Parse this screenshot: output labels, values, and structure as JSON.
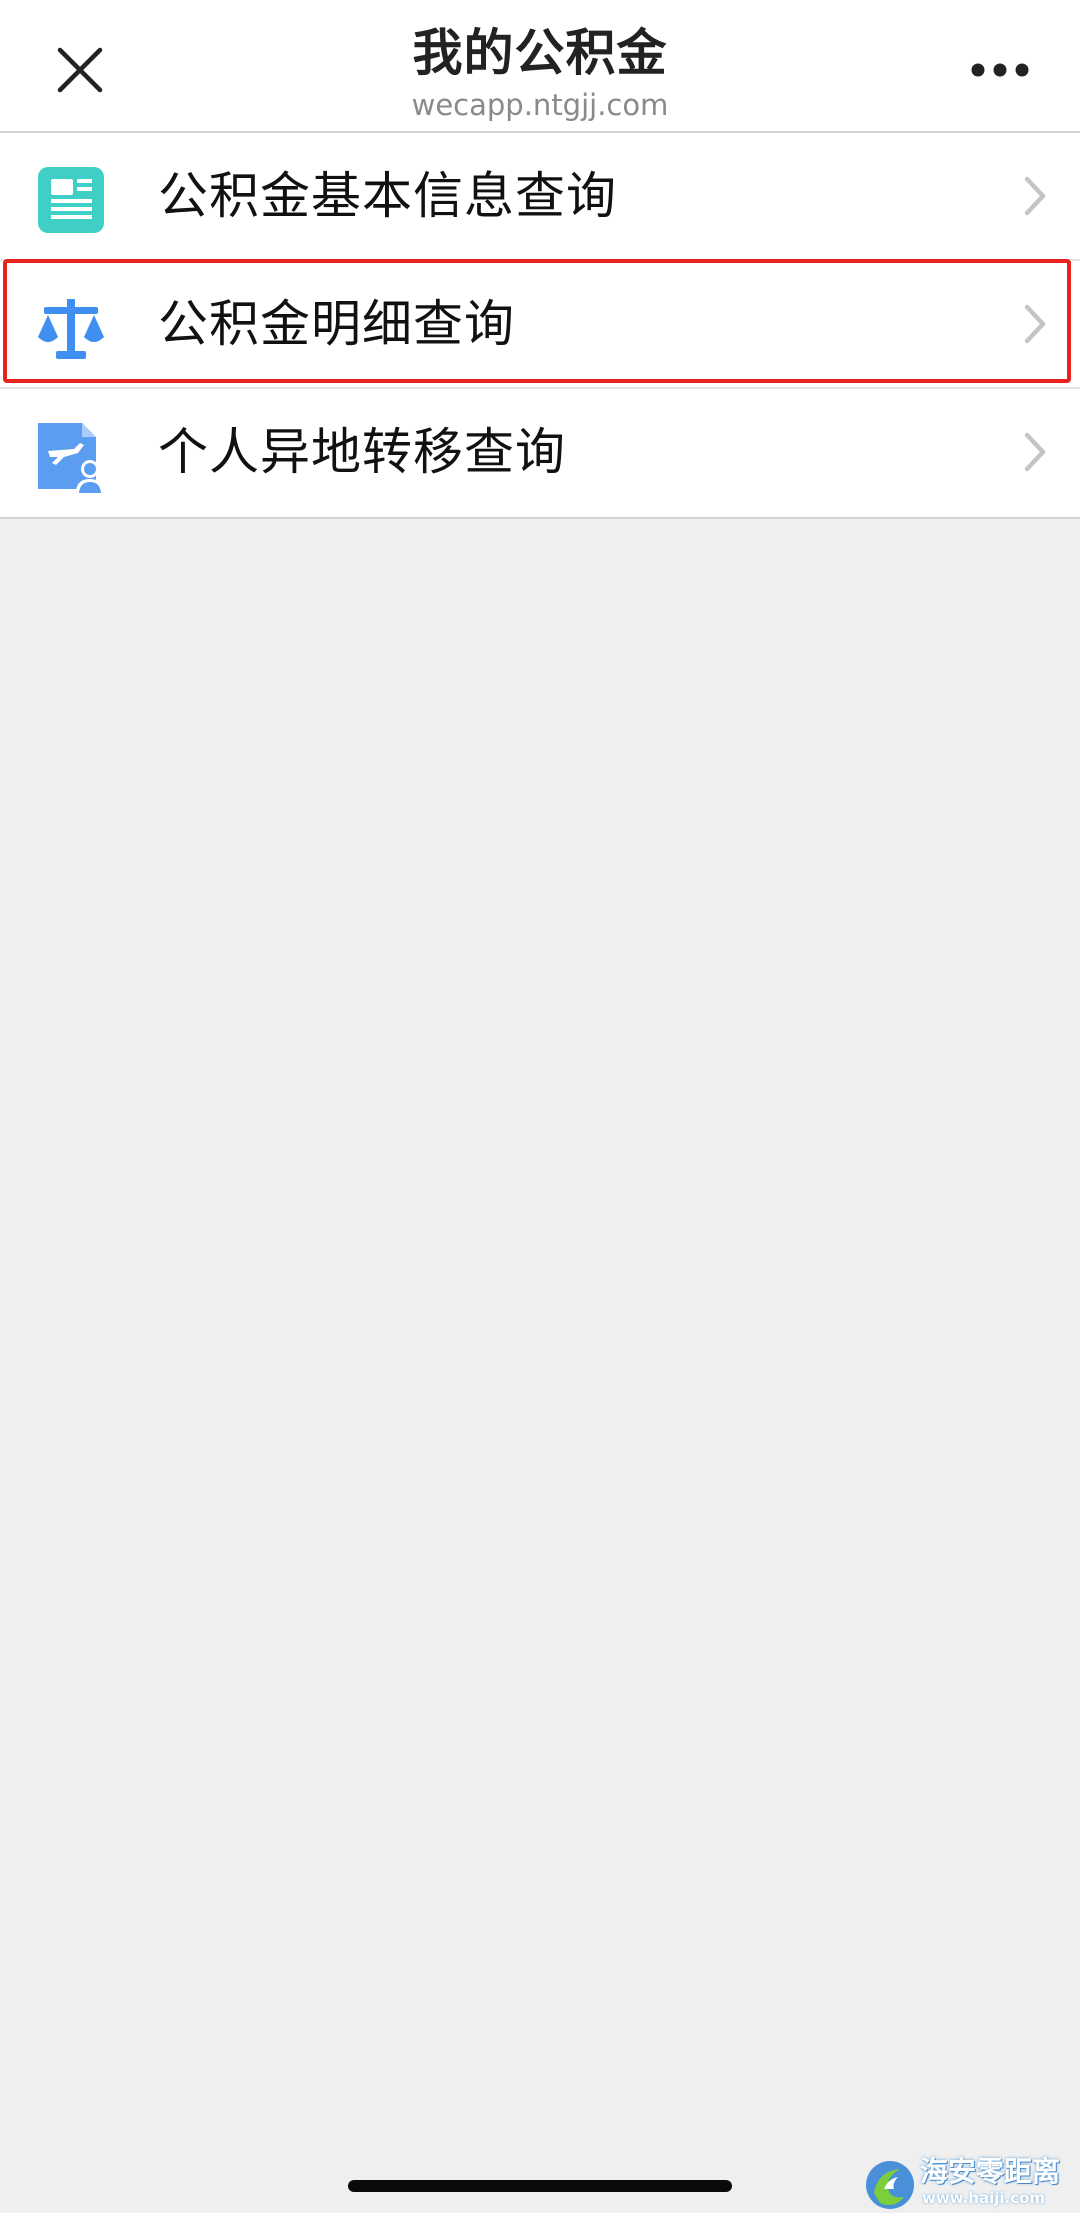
{
  "header": {
    "title": "我的公积金",
    "subtitle": "wecapp.ntgjj.com",
    "close_icon": "close-icon",
    "more_icon": "more-icon"
  },
  "menu": {
    "items": [
      {
        "label": "公积金基本信息查询",
        "icon": "document-list-icon",
        "highlighted": false
      },
      {
        "label": "公积金明细查询",
        "icon": "balance-scale-icon",
        "highlighted": true
      },
      {
        "label": "个人异地转移查询",
        "icon": "transfer-person-icon",
        "highlighted": false
      }
    ]
  },
  "colors": {
    "highlight": "#e8231e",
    "icon_teal": "#3fcfc4",
    "icon_blue": "#3f8ff0",
    "background": "#efefef"
  },
  "watermark": {
    "text": "海安零距离",
    "url": "www.haiji.com"
  }
}
